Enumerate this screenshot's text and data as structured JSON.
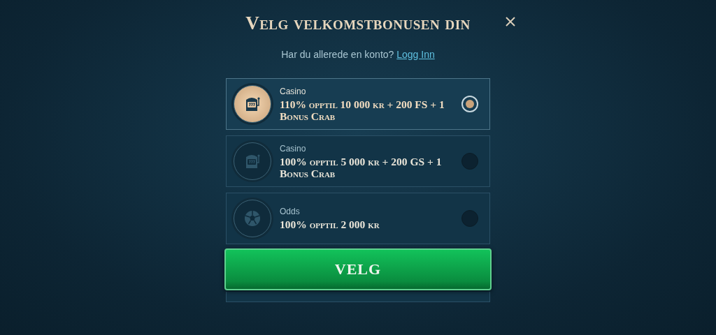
{
  "dialog": {
    "title": "Velg velkomstbonusen din",
    "subtitle": "Har du allerede en konto?",
    "login_link": "Logg Inn"
  },
  "bonuses": [
    {
      "category": "Casino",
      "offer": "110% opptil 10 000 kr + 200 FS + 1 Bonus Crab",
      "kind": "slot",
      "selected": true
    },
    {
      "category": "Casino",
      "offer": "100% opptil 5 000 kr + 200 GS + 1 Bonus Crab",
      "kind": "slot",
      "selected": false
    },
    {
      "category": "Odds",
      "offer": "100% opptil 2 000 kr",
      "kind": "ball",
      "selected": false
    }
  ],
  "button": "VELG"
}
